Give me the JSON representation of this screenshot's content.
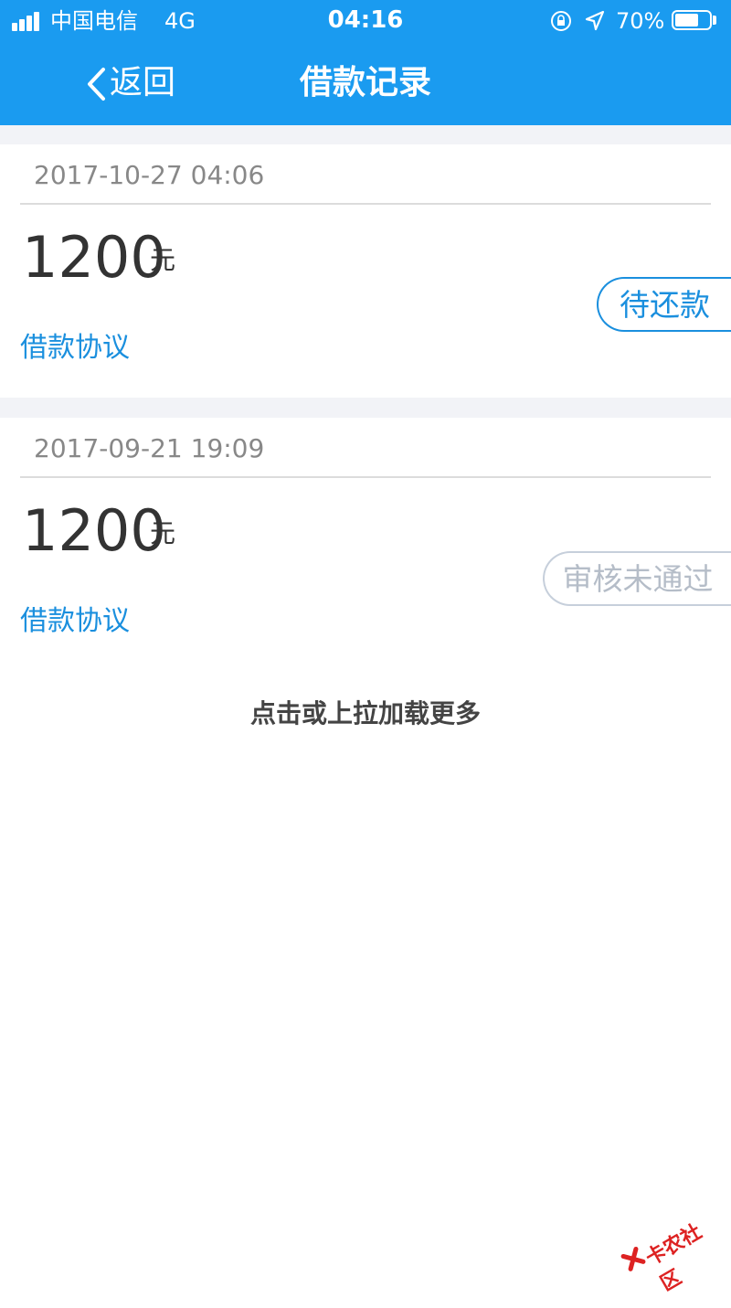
{
  "status_bar": {
    "carrier": "中国电信",
    "network": "4G",
    "time": "04:16",
    "battery": "70%",
    "battery_level": 0.7,
    "icons": [
      "signal-icon",
      "orientation-lock-icon",
      "location-icon",
      "battery-icon"
    ]
  },
  "nav": {
    "back_label": "返回",
    "title": "借款记录",
    "color": "#1a9bf0"
  },
  "records": [
    {
      "date": "2017-10-27 04:06",
      "amount": "1200",
      "unit": "元",
      "link": "借款协议",
      "status": "待还款",
      "status_color": "#1a8fde"
    },
    {
      "date": "2017-09-21 19:09",
      "amount": "1200",
      "unit": "元",
      "link": "借款协议",
      "status": "审核未通过",
      "status_color": "#b5bdc8"
    }
  ],
  "load_more": "点击或上拉加载更多",
  "watermark": "卡农社区"
}
